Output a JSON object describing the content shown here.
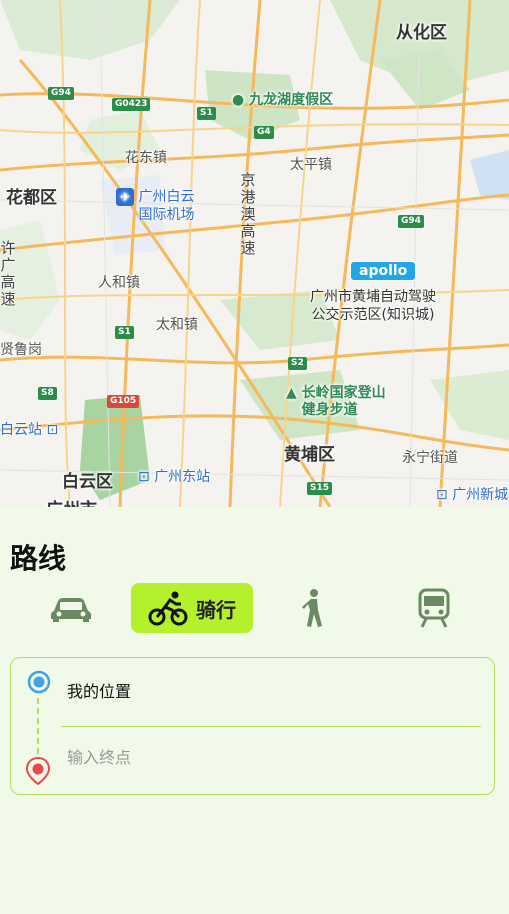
{
  "map": {
    "districts": [
      "从化区",
      "花都区",
      "白云区",
      "黄埔区",
      "广州市"
    ],
    "places": [
      "九龙湖度假区",
      "花东镇",
      "太平镇",
      "人和镇",
      "太和镇",
      "永宁街道",
      "许广高速",
      "贤鲁岗",
      "长岭国家登山健身步道"
    ],
    "poi_airport": [
      "广州白云",
      "国际机场"
    ],
    "poi_trail": [
      "长岭国家登山",
      "健身步道"
    ],
    "stations": [
      "白云站",
      "广州东站",
      "广州新城"
    ],
    "expressway": [
      "京",
      "港",
      "澳",
      "高",
      "速"
    ],
    "xuguang": [
      "许",
      "广",
      "高",
      "速"
    ],
    "apollo": "apollo",
    "apollo_desc": [
      "广州市黄埔自动驾驶",
      "公交示范区(知识城)"
    ],
    "shields": [
      "G94",
      "G0423",
      "S1",
      "G4",
      "G94",
      "S1",
      "S2",
      "S8",
      "G105",
      "S15"
    ]
  },
  "panel": {
    "title": "路线",
    "modes": [
      {
        "name": "car",
        "icon": "car-icon",
        "label": ""
      },
      {
        "name": "bike",
        "icon": "bike-icon",
        "label": "骑行",
        "active": true
      },
      {
        "name": "walk",
        "icon": "walk-icon",
        "label": ""
      },
      {
        "name": "transit",
        "icon": "train-icon",
        "label": ""
      }
    ],
    "origin": "我的位置",
    "destination_placeholder": "输入终点"
  },
  "colors": {
    "accent": "#b4f02c",
    "origin_dot": "#3ba3e6",
    "dest_pin": "#e84b4b",
    "border": "#b4e05a"
  }
}
